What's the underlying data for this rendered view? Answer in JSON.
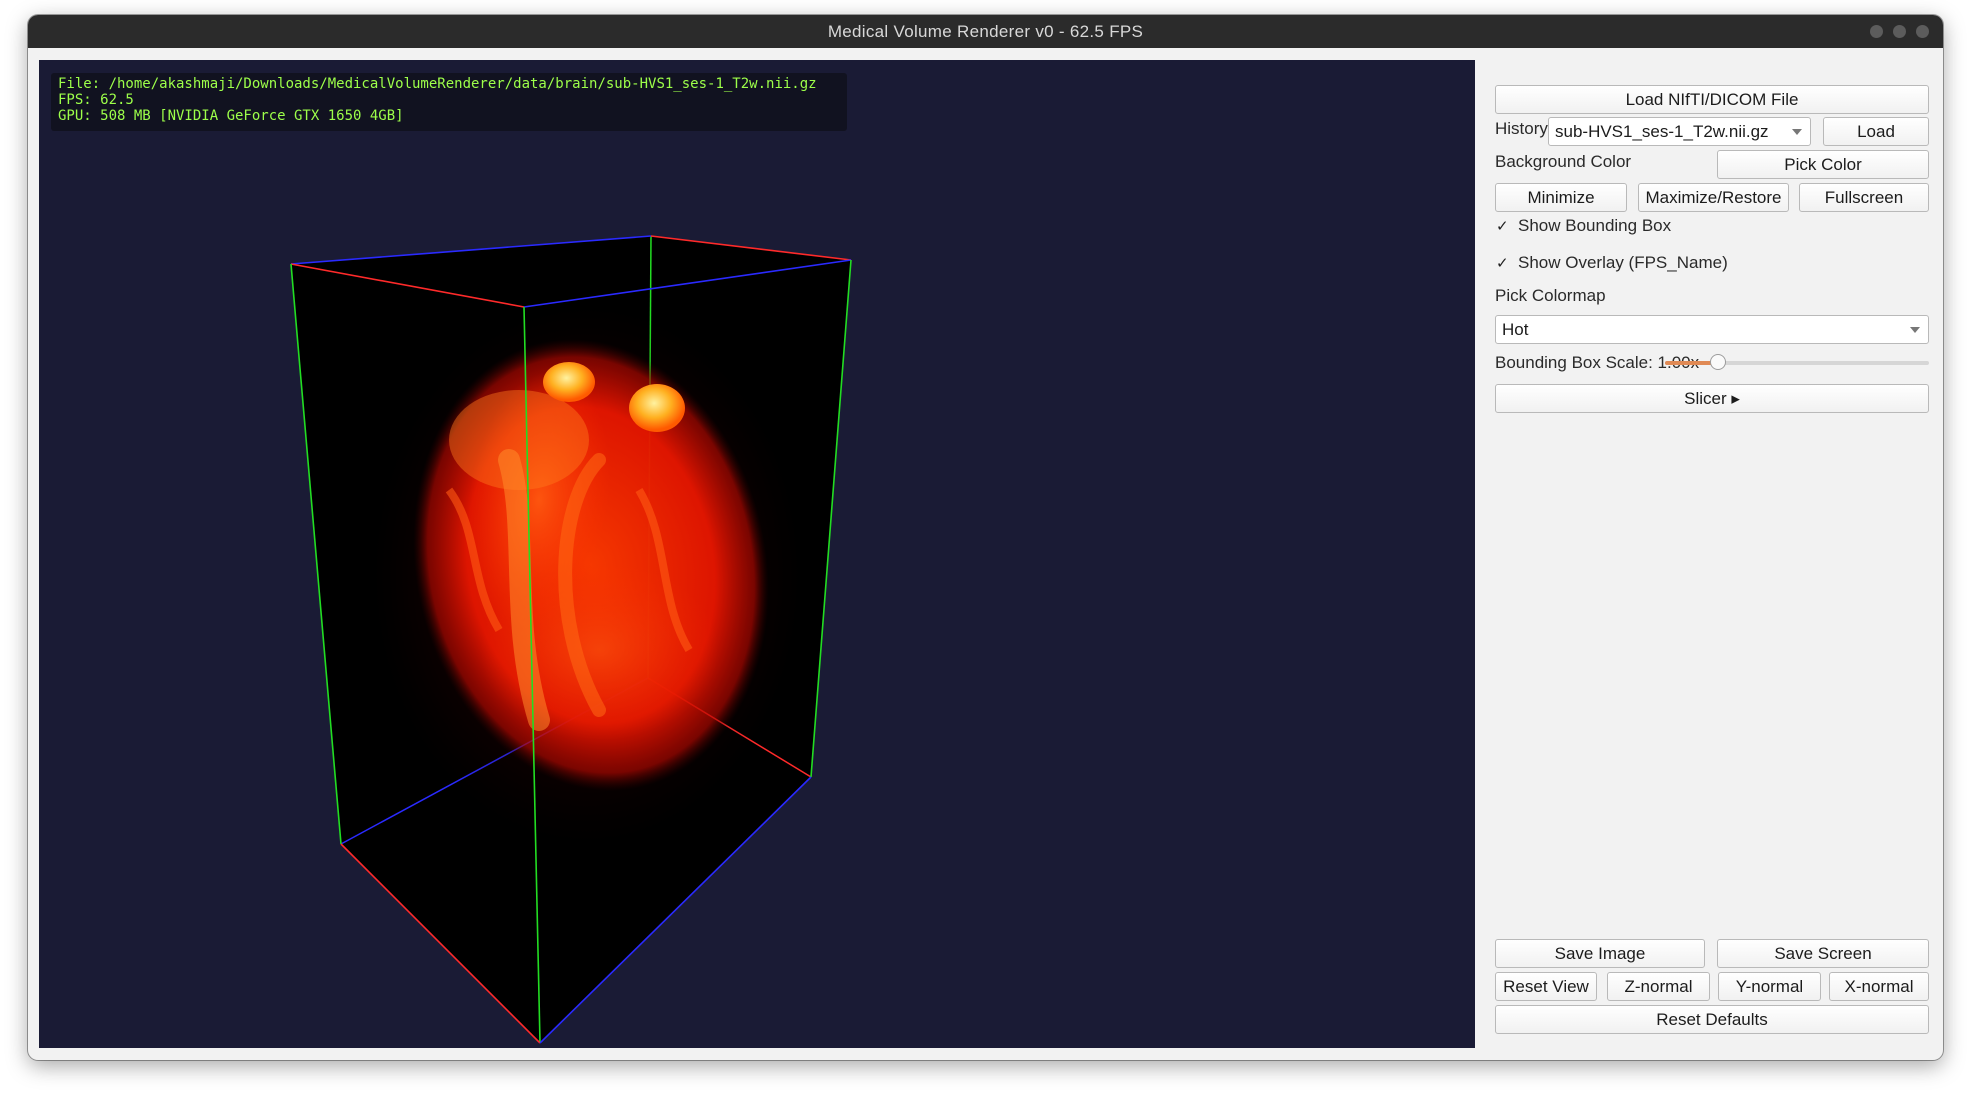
{
  "window": {
    "title": "Medical Volume Renderer v0 - 62.5 FPS"
  },
  "overlay": {
    "file_line": "File: /home/akashmaji/Downloads/MedicalVolumeRenderer/data/brain/sub-HVS1_ses-1_T2w.nii.gz",
    "fps_line": "FPS: 62.5",
    "gpu_line": "GPU: 508 MB [NVIDIA GeForce GTX 1650 4GB]"
  },
  "viewport": {
    "background_color": "#1a1b35",
    "bbox_edge_colors": [
      "#ff2a2a",
      "#2a2aff",
      "#22dd22"
    ],
    "volume_colormap": "Hot"
  },
  "panel": {
    "load_button": "Load NIfTI/DICOM File",
    "history_label": "History",
    "history_value": "sub-HVS1_ses-1_T2w.nii.gz",
    "history_load_button": "Load",
    "background_color_label": "Background Color",
    "pick_color_button": "Pick Color",
    "minimize_button": "Minimize",
    "maximize_button": "Maximize/Restore",
    "fullscreen_button": "Fullscreen",
    "show_bounding_box": {
      "label": "Show Bounding Box",
      "checked": true
    },
    "show_overlay": {
      "label": "Show Overlay (FPS_Name)",
      "checked": true
    },
    "check_mark": "✓",
    "colormap_label": "Pick Colormap",
    "colormap_value": "Hot",
    "bbox_scale_label": "Bounding Box Scale: 1.00x",
    "bbox_scale_fraction": 0.2,
    "slicer_button": "Slicer ▸",
    "save_image_button": "Save Image",
    "save_screen_button": "Save Screen",
    "reset_view_button": "Reset View",
    "z_normal_button": "Z-normal",
    "y_normal_button": "Y-normal",
    "x_normal_button": "X-normal",
    "reset_defaults_button": "Reset Defaults"
  }
}
